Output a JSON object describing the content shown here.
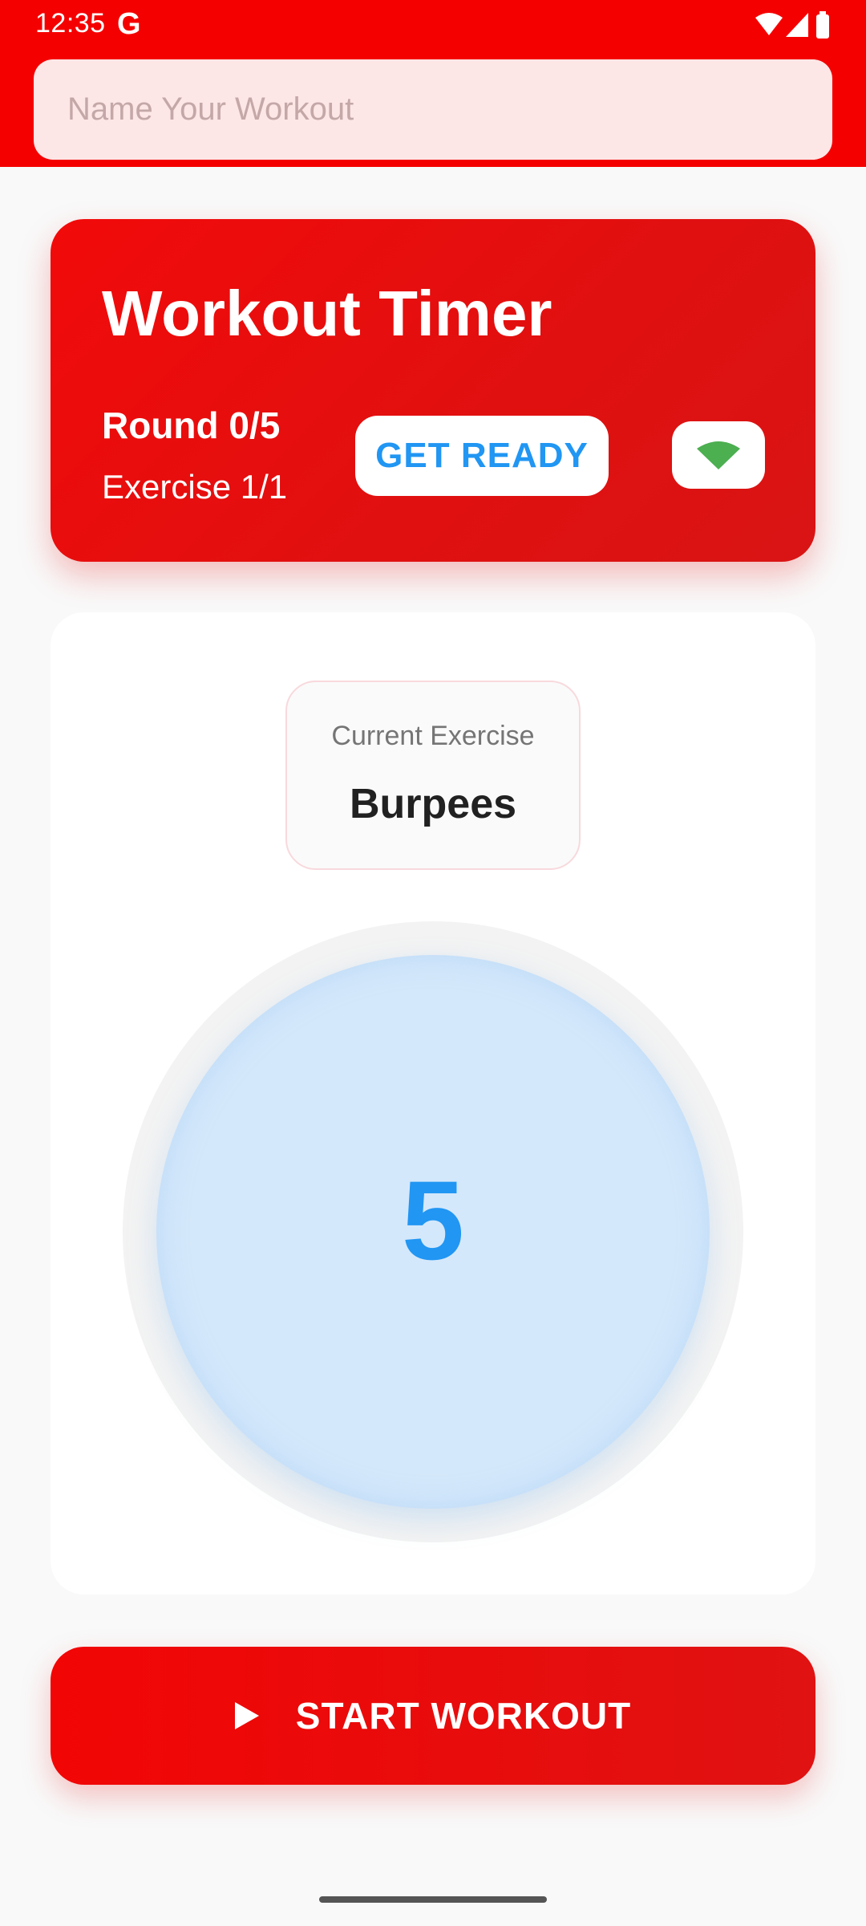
{
  "status_bar": {
    "time": "12:35",
    "g_icon": "G"
  },
  "header": {
    "name_input_placeholder": "Name Your Workout",
    "name_input_value": ""
  },
  "timer_card": {
    "title": "Workout Timer",
    "round": "Round 0/5",
    "exercise_count": "Exercise 1/1",
    "state_badge": "GET READY",
    "connection_icon": "wifi-icon"
  },
  "main_card": {
    "exercise_label": "Current Exercise",
    "exercise_name": "Burpees",
    "countdown": "5"
  },
  "start_button": {
    "label": "START WORKOUT",
    "icon": "play-icon"
  },
  "colors": {
    "primary_red": "#f50000",
    "accent_blue": "#2196f3",
    "wifi_green": "#4caf50"
  }
}
